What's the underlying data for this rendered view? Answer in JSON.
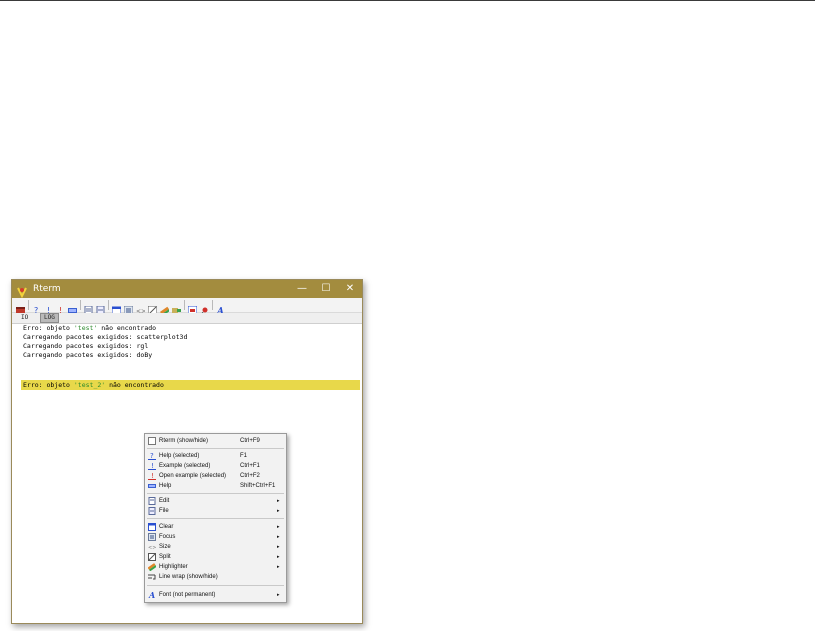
{
  "window": {
    "title": "Rterm",
    "minimize": "—",
    "maximize": "☐",
    "close": "✕"
  },
  "tabs": [
    {
      "label": "IO"
    },
    {
      "label": "LOG"
    }
  ],
  "console": {
    "lines": [
      {
        "prefix": "Erro: objeto ",
        "quoted": "'test'",
        "suffix": " não encontrado"
      },
      {
        "text": "Carregando pacotes exigidos: scatterplot3d"
      },
      {
        "text": "Carregando pacotes exigidos: rgl"
      },
      {
        "text": "Carregando pacotes exigidos: doBy"
      },
      {
        "prefix": "Erro: objeto ",
        "quoted": "'test_2'",
        "suffix": " não encontrado"
      }
    ],
    "highlight_color": "#e8d84a"
  },
  "menu": {
    "items": [
      {
        "label": "Rterm (show/hide)",
        "shortcut": "Ctrl+F9",
        "icon": "window-toggle-icon"
      },
      {
        "label": "Help (selected)",
        "shortcut": "F1",
        "icon": "help-icon"
      },
      {
        "label": "Example (selected)",
        "shortcut": "Ctrl+F1",
        "icon": "example-icon"
      },
      {
        "label": "Open example (selected)",
        "shortcut": "Ctrl+F2",
        "icon": "open-example-icon"
      },
      {
        "label": "Help",
        "shortcut": "Shift+Ctrl+F1",
        "icon": "help-browser-icon"
      },
      {
        "label": "Edit",
        "submenu": "▸",
        "icon": "edit-icon"
      },
      {
        "label": "File",
        "submenu": "▸",
        "icon": "file-icon"
      },
      {
        "label": "Clear",
        "submenu": "▸",
        "icon": "clear-icon"
      },
      {
        "label": "Focus",
        "submenu": "▸",
        "icon": "focus-icon"
      },
      {
        "label": "Size",
        "submenu": "▸",
        "icon": "size-icon"
      },
      {
        "label": "Split",
        "submenu": "▸",
        "icon": "split-icon"
      },
      {
        "label": "Highlighter",
        "submenu": "▸",
        "icon": "highlighter-icon"
      },
      {
        "label": "Line wrap (show/hide)",
        "icon": "line-wrap-icon"
      },
      {
        "label": "Font (not permanent)",
        "submenu": "▸",
        "icon": "font-icon"
      }
    ]
  },
  "colors": {
    "titlebar": "#a38c3e",
    "highlight": "#e8d84a",
    "string": "#2c8a2c"
  }
}
